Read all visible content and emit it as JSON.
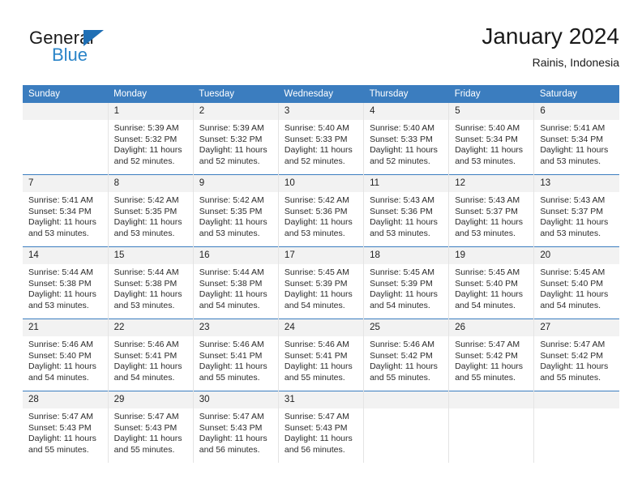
{
  "brand": {
    "name_top": "General",
    "name_bottom": "Blue",
    "accent_color": "#1f6fb5",
    "blue_text_color": "#2a84c8",
    "triangle_icon": "triangle-icon"
  },
  "header": {
    "title": "January 2024",
    "subtitle": "Rainis, Indonesia"
  },
  "theme": {
    "header_row_bg": "#3b7dbf",
    "header_row_text": "#ffffff",
    "daynum_bg": "#f2f2f2",
    "row_divider": "#3b7dbf",
    "column_divider": "#e4e4e4",
    "body_text": "#2b2b2b"
  },
  "calendar": {
    "weekday_headers": [
      "Sunday",
      "Monday",
      "Tuesday",
      "Wednesday",
      "Thursday",
      "Friday",
      "Saturday"
    ],
    "weeks": [
      [
        {
          "day": "",
          "sunrise": "",
          "sunset": "",
          "daylight": "",
          "empty": true
        },
        {
          "day": "1",
          "sunrise": "Sunrise: 5:39 AM",
          "sunset": "Sunset: 5:32 PM",
          "daylight": "Daylight: 11 hours and 52 minutes."
        },
        {
          "day": "2",
          "sunrise": "Sunrise: 5:39 AM",
          "sunset": "Sunset: 5:32 PM",
          "daylight": "Daylight: 11 hours and 52 minutes."
        },
        {
          "day": "3",
          "sunrise": "Sunrise: 5:40 AM",
          "sunset": "Sunset: 5:33 PM",
          "daylight": "Daylight: 11 hours and 52 minutes."
        },
        {
          "day": "4",
          "sunrise": "Sunrise: 5:40 AM",
          "sunset": "Sunset: 5:33 PM",
          "daylight": "Daylight: 11 hours and 52 minutes."
        },
        {
          "day": "5",
          "sunrise": "Sunrise: 5:40 AM",
          "sunset": "Sunset: 5:34 PM",
          "daylight": "Daylight: 11 hours and 53 minutes."
        },
        {
          "day": "6",
          "sunrise": "Sunrise: 5:41 AM",
          "sunset": "Sunset: 5:34 PM",
          "daylight": "Daylight: 11 hours and 53 minutes."
        }
      ],
      [
        {
          "day": "7",
          "sunrise": "Sunrise: 5:41 AM",
          "sunset": "Sunset: 5:34 PM",
          "daylight": "Daylight: 11 hours and 53 minutes."
        },
        {
          "day": "8",
          "sunrise": "Sunrise: 5:42 AM",
          "sunset": "Sunset: 5:35 PM",
          "daylight": "Daylight: 11 hours and 53 minutes."
        },
        {
          "day": "9",
          "sunrise": "Sunrise: 5:42 AM",
          "sunset": "Sunset: 5:35 PM",
          "daylight": "Daylight: 11 hours and 53 minutes."
        },
        {
          "day": "10",
          "sunrise": "Sunrise: 5:42 AM",
          "sunset": "Sunset: 5:36 PM",
          "daylight": "Daylight: 11 hours and 53 minutes."
        },
        {
          "day": "11",
          "sunrise": "Sunrise: 5:43 AM",
          "sunset": "Sunset: 5:36 PM",
          "daylight": "Daylight: 11 hours and 53 minutes."
        },
        {
          "day": "12",
          "sunrise": "Sunrise: 5:43 AM",
          "sunset": "Sunset: 5:37 PM",
          "daylight": "Daylight: 11 hours and 53 minutes."
        },
        {
          "day": "13",
          "sunrise": "Sunrise: 5:43 AM",
          "sunset": "Sunset: 5:37 PM",
          "daylight": "Daylight: 11 hours and 53 minutes."
        }
      ],
      [
        {
          "day": "14",
          "sunrise": "Sunrise: 5:44 AM",
          "sunset": "Sunset: 5:38 PM",
          "daylight": "Daylight: 11 hours and 53 minutes."
        },
        {
          "day": "15",
          "sunrise": "Sunrise: 5:44 AM",
          "sunset": "Sunset: 5:38 PM",
          "daylight": "Daylight: 11 hours and 53 minutes."
        },
        {
          "day": "16",
          "sunrise": "Sunrise: 5:44 AM",
          "sunset": "Sunset: 5:38 PM",
          "daylight": "Daylight: 11 hours and 54 minutes."
        },
        {
          "day": "17",
          "sunrise": "Sunrise: 5:45 AM",
          "sunset": "Sunset: 5:39 PM",
          "daylight": "Daylight: 11 hours and 54 minutes."
        },
        {
          "day": "18",
          "sunrise": "Sunrise: 5:45 AM",
          "sunset": "Sunset: 5:39 PM",
          "daylight": "Daylight: 11 hours and 54 minutes."
        },
        {
          "day": "19",
          "sunrise": "Sunrise: 5:45 AM",
          "sunset": "Sunset: 5:40 PM",
          "daylight": "Daylight: 11 hours and 54 minutes."
        },
        {
          "day": "20",
          "sunrise": "Sunrise: 5:45 AM",
          "sunset": "Sunset: 5:40 PM",
          "daylight": "Daylight: 11 hours and 54 minutes."
        }
      ],
      [
        {
          "day": "21",
          "sunrise": "Sunrise: 5:46 AM",
          "sunset": "Sunset: 5:40 PM",
          "daylight": "Daylight: 11 hours and 54 minutes."
        },
        {
          "day": "22",
          "sunrise": "Sunrise: 5:46 AM",
          "sunset": "Sunset: 5:41 PM",
          "daylight": "Daylight: 11 hours and 54 minutes."
        },
        {
          "day": "23",
          "sunrise": "Sunrise: 5:46 AM",
          "sunset": "Sunset: 5:41 PM",
          "daylight": "Daylight: 11 hours and 55 minutes."
        },
        {
          "day": "24",
          "sunrise": "Sunrise: 5:46 AM",
          "sunset": "Sunset: 5:41 PM",
          "daylight": "Daylight: 11 hours and 55 minutes."
        },
        {
          "day": "25",
          "sunrise": "Sunrise: 5:46 AM",
          "sunset": "Sunset: 5:42 PM",
          "daylight": "Daylight: 11 hours and 55 minutes."
        },
        {
          "day": "26",
          "sunrise": "Sunrise: 5:47 AM",
          "sunset": "Sunset: 5:42 PM",
          "daylight": "Daylight: 11 hours and 55 minutes."
        },
        {
          "day": "27",
          "sunrise": "Sunrise: 5:47 AM",
          "sunset": "Sunset: 5:42 PM",
          "daylight": "Daylight: 11 hours and 55 minutes."
        }
      ],
      [
        {
          "day": "28",
          "sunrise": "Sunrise: 5:47 AM",
          "sunset": "Sunset: 5:43 PM",
          "daylight": "Daylight: 11 hours and 55 minutes."
        },
        {
          "day": "29",
          "sunrise": "Sunrise: 5:47 AM",
          "sunset": "Sunset: 5:43 PM",
          "daylight": "Daylight: 11 hours and 55 minutes."
        },
        {
          "day": "30",
          "sunrise": "Sunrise: 5:47 AM",
          "sunset": "Sunset: 5:43 PM",
          "daylight": "Daylight: 11 hours and 56 minutes."
        },
        {
          "day": "31",
          "sunrise": "Sunrise: 5:47 AM",
          "sunset": "Sunset: 5:43 PM",
          "daylight": "Daylight: 11 hours and 56 minutes."
        },
        {
          "day": "",
          "sunrise": "",
          "sunset": "",
          "daylight": "",
          "empty": true
        },
        {
          "day": "",
          "sunrise": "",
          "sunset": "",
          "daylight": "",
          "empty": true
        },
        {
          "day": "",
          "sunrise": "",
          "sunset": "",
          "daylight": "",
          "empty": true
        }
      ]
    ]
  }
}
